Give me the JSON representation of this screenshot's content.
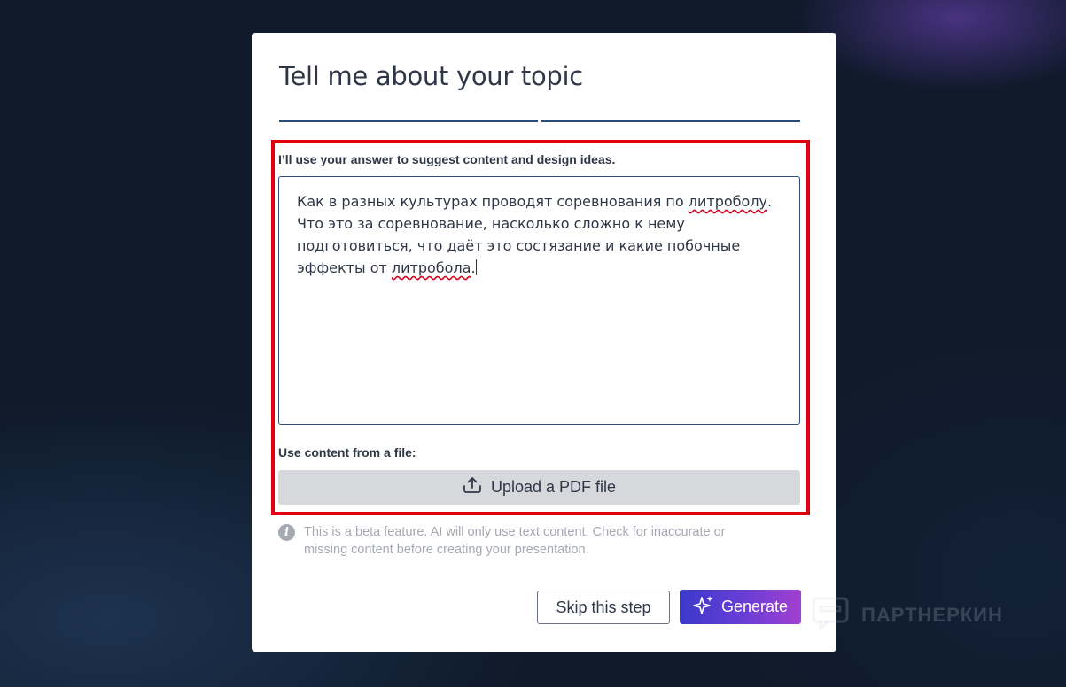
{
  "dialog": {
    "title": "Tell me about your topic",
    "hint": "I’ll use your answer to suggest content and design ideas.",
    "topic": {
      "line1_pre": "Как в разных культурах проводят соревнования по ",
      "line1_word": "литроболу",
      "line1_post": ".",
      "line2": "Что это за соревнование, насколько сложно к нему",
      "line3": "подготовиться, что даёт это состязание и какие побочные",
      "line4_pre": "эффекты от ",
      "line4_word": "литробола",
      "line4_post": "."
    },
    "file_label": "Use content from a file:",
    "upload_label": "Upload a PDF file",
    "beta_line1": "This is a beta feature. AI will only use text content. Check for inaccurate or",
    "beta_line2": "missing content before creating your presentation.",
    "info_glyph": "i",
    "skip_label": "Skip this step",
    "generate_label": "Generate"
  },
  "watermark": {
    "text": "ПАРТНЕРКИН"
  },
  "colors": {
    "accent_gradient_start": "#3b39c9",
    "accent_gradient_end": "#a23fd0",
    "highlight_border": "#e00010",
    "progress": "#2b4c78"
  },
  "icons": {
    "upload": "upload-icon",
    "sparkle": "sparkle-icon",
    "info": "info-icon"
  }
}
